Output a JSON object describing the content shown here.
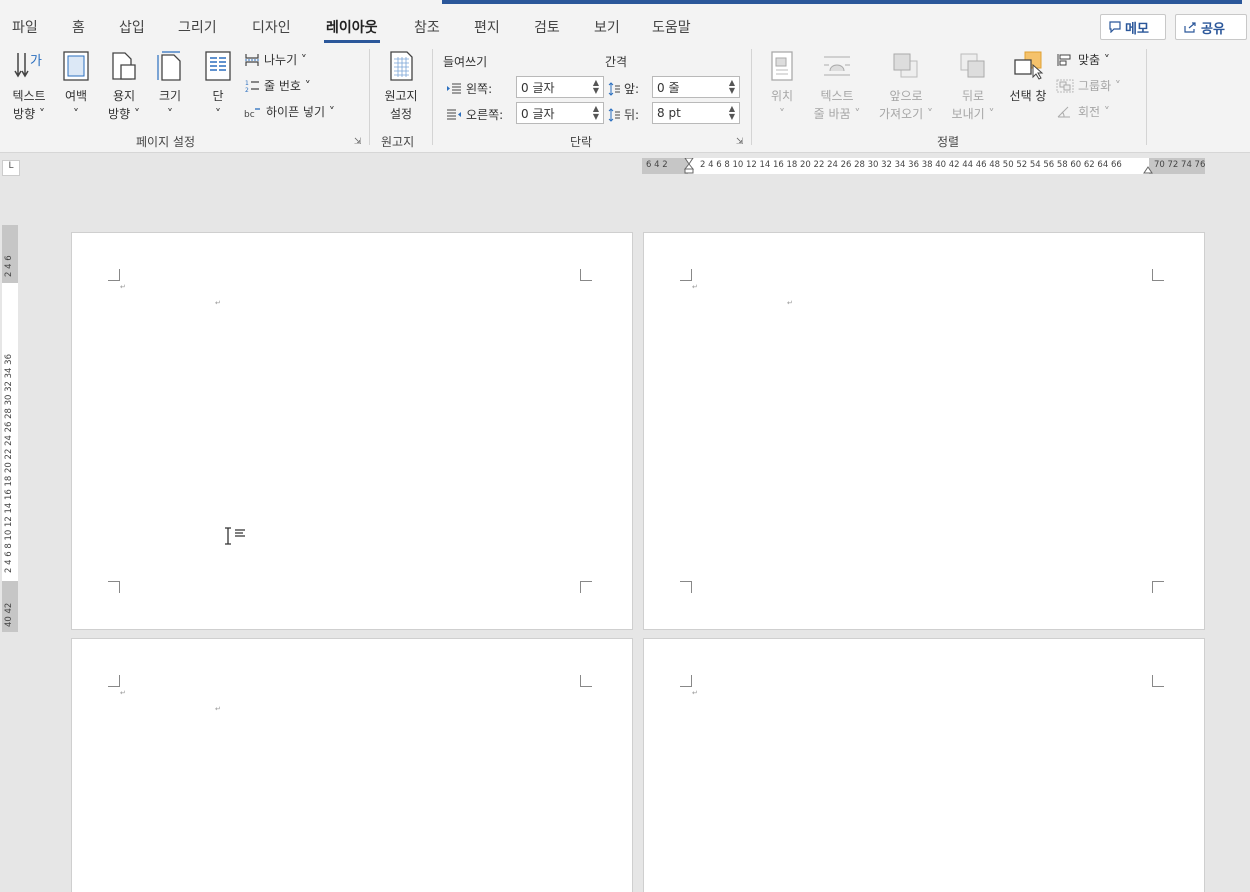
{
  "tabs": [
    "파일",
    "홈",
    "삽입",
    "그리기",
    "디자인",
    "레이아웃",
    "참조",
    "편지",
    "검토",
    "보기",
    "도움말"
  ],
  "active_tab": "레이아웃",
  "top_buttons": {
    "memo": "메모",
    "share": "공유"
  },
  "page_setup": {
    "text_direction": [
      "텍스트",
      "방향 ˅"
    ],
    "margins": [
      "여백",
      "˅"
    ],
    "orientation": [
      "용지",
      "방향 ˅"
    ],
    "size": [
      "크기",
      "˅"
    ],
    "columns": [
      "단",
      "˅"
    ],
    "breaks": "나누기 ˅",
    "line_numbers": "줄 번호 ˅",
    "hyphenation": "하이픈 넣기 ˅",
    "group_label": "페이지 설정"
  },
  "manuscript": {
    "settings": [
      "원고지",
      "설정"
    ],
    "group_label": "원고지"
  },
  "paragraph": {
    "indent_title": "들여쓰기",
    "spacing_title": "간격",
    "left_label": "왼쪽:",
    "right_label": "오른쪽:",
    "before_label": "앞:",
    "after_label": "뒤:",
    "left_value": "0 글자",
    "right_value": "0 글자",
    "before_value": "0 줄",
    "after_value": "8 pt",
    "group_label": "단락"
  },
  "arrange": {
    "position": [
      "위치",
      "˅"
    ],
    "wrap_text": [
      "텍스트",
      "줄 바꿈 ˅"
    ],
    "bring_forward": [
      "앞으로",
      "가져오기 ˅"
    ],
    "send_backward": [
      "뒤로",
      "보내기 ˅"
    ],
    "selection_pane": "선택 창",
    "align": "맞춤 ˅",
    "group": "그룹화 ˅",
    "rotate": "회전 ˅",
    "group_label": "정렬"
  },
  "ruler": {
    "h_left": "6  4  2",
    "h_main": "2  4  6  8 10 12 14 16 18 20 22 24 26 28 30 32 34 36 38 40 42 44 46 48 50 52 54 56 58 60 62 64 66",
    "h_right": "70 72 74 76",
    "v_top": "2  4  6",
    "v_main": "2  4  6  8 10 12 14 16 18 20 22 24 26 28 30 32 34 36",
    "v_bottom": "40 42",
    "corner": "L"
  },
  "colors": {
    "accent": "#2b579a",
    "ribbon_bg": "#f3f3f3",
    "workspace": "#e6e6e6"
  }
}
